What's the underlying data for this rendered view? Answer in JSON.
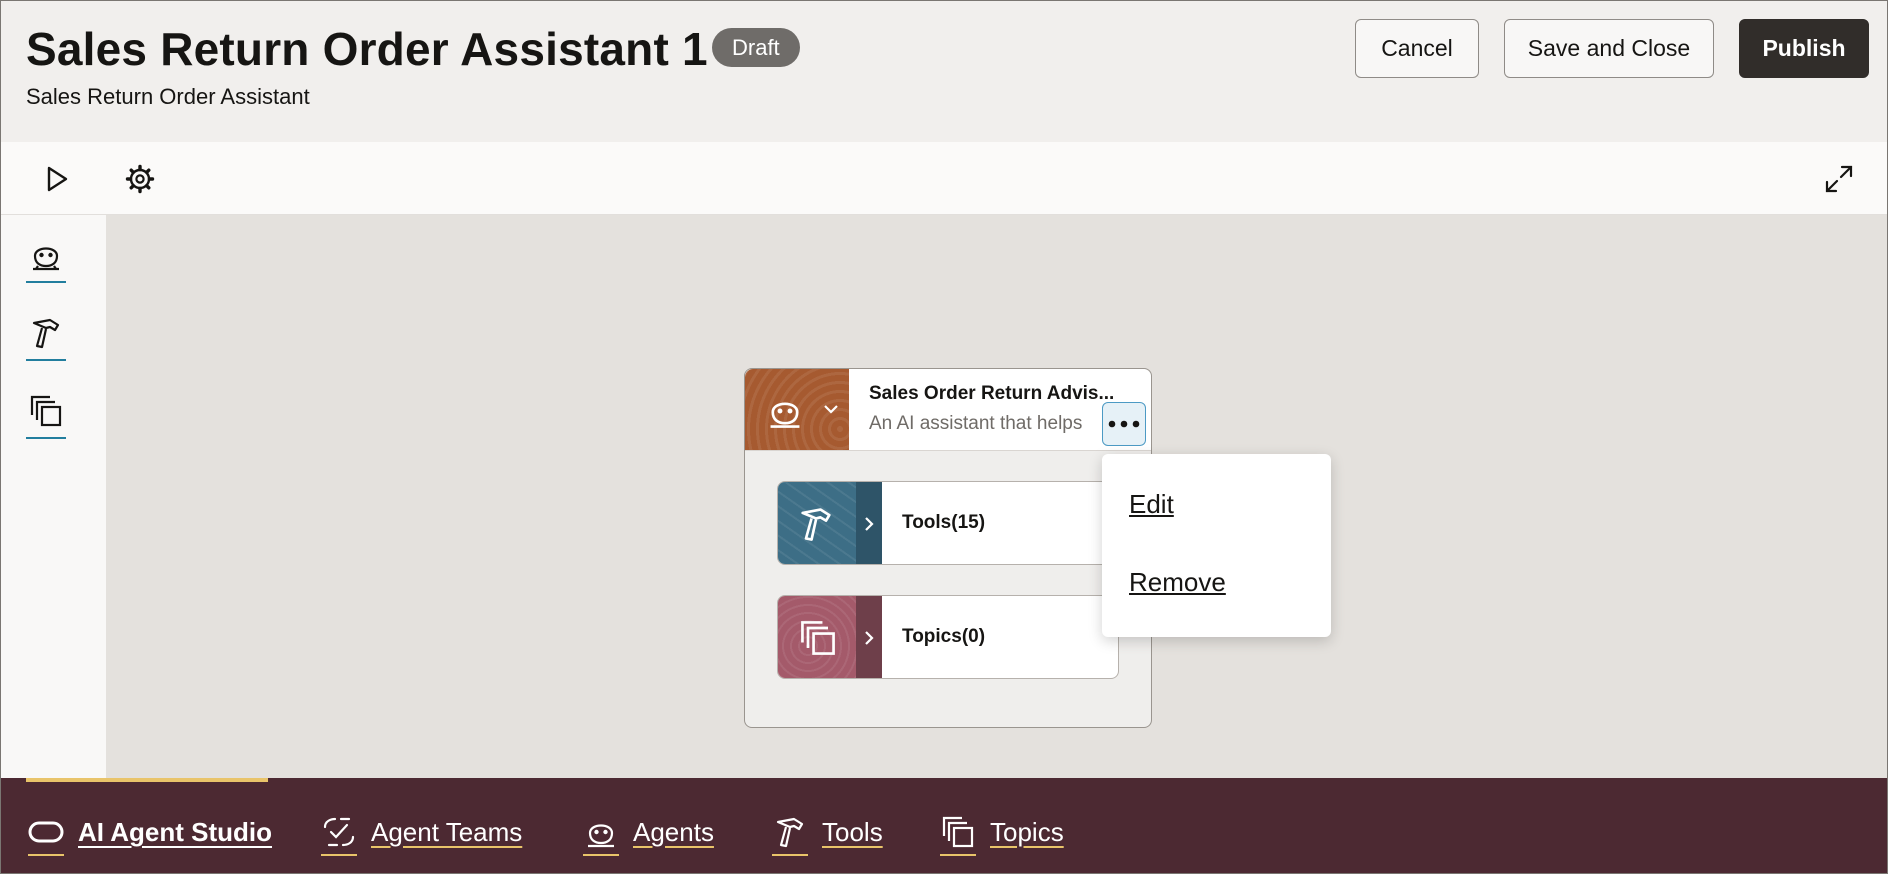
{
  "header": {
    "title": "Sales Return Order Assistant 1",
    "status_badge": "Draft",
    "subtitle": "Sales Return Order Assistant",
    "cancel_label": "Cancel",
    "save_close_label": "Save and Close",
    "publish_label": "Publish"
  },
  "toolbar": {
    "icons": [
      "play-icon",
      "gear-icon",
      "expand-icon"
    ]
  },
  "rail": {
    "items": [
      "agent-icon",
      "tool-hammer-icon",
      "topics-icon"
    ]
  },
  "canvas": {
    "node": {
      "title": "Sales Order Return Advis...",
      "description": "An AI assistant that helps",
      "header_color": "#a65a30"
    },
    "children": [
      {
        "label": "Tools(15)",
        "color": "#3d6e86",
        "chev_color": "#2e5468"
      },
      {
        "label": "Topics(0)",
        "color": "#a45a6a",
        "chev_color": "#6e3f4a"
      }
    ],
    "context_menu": {
      "items": [
        "Edit",
        "Remove"
      ]
    }
  },
  "bottom_nav": {
    "items": [
      {
        "label": "AI Agent Studio",
        "icon": "oracle-logo-icon",
        "active": true
      },
      {
        "label": "Agent Teams",
        "icon": "agent-teams-icon"
      },
      {
        "label": "Agents",
        "icon": "agent-icon"
      },
      {
        "label": "Tools",
        "icon": "tool-hammer-icon"
      },
      {
        "label": "Topics",
        "icon": "topics-icon"
      }
    ],
    "accent": "#e9c46a",
    "background": "#4c2932"
  }
}
